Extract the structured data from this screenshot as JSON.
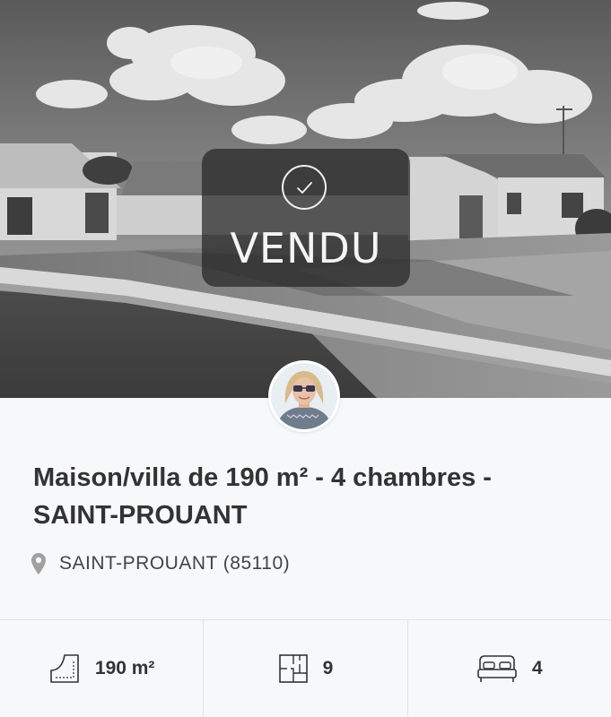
{
  "listing": {
    "title": "Maison/villa de 190 m² - 4 chambres - SAINT-PROUANT",
    "status_label": "VENDU",
    "location": "SAINT-PROUANT (85110)"
  },
  "stats": {
    "area": "190 m²",
    "rooms": "9",
    "bedrooms": "4"
  },
  "icons": {
    "sold": "check-circle-icon",
    "location": "map-pin-icon",
    "area": "surface-area-icon",
    "rooms": "floor-plan-icon",
    "bedrooms": "bed-icon"
  },
  "colors": {
    "title": "#333333",
    "text": "#444444",
    "icon": "#9a9a9a",
    "border": "#dfe3e8",
    "overlay": "#262626"
  }
}
